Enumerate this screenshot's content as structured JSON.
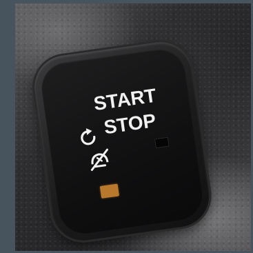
{
  "image": {
    "subject": "",
    "background_color": "#47545e"
  },
  "button": {
    "label_line1": "START",
    "label_line2": "STOP",
    "icons": [
      "restart-arrow-icon",
      "auto-stop-off-icon"
    ],
    "indicator_colors": {
      "amber": "#b8792c",
      "off": "#050505"
    }
  }
}
